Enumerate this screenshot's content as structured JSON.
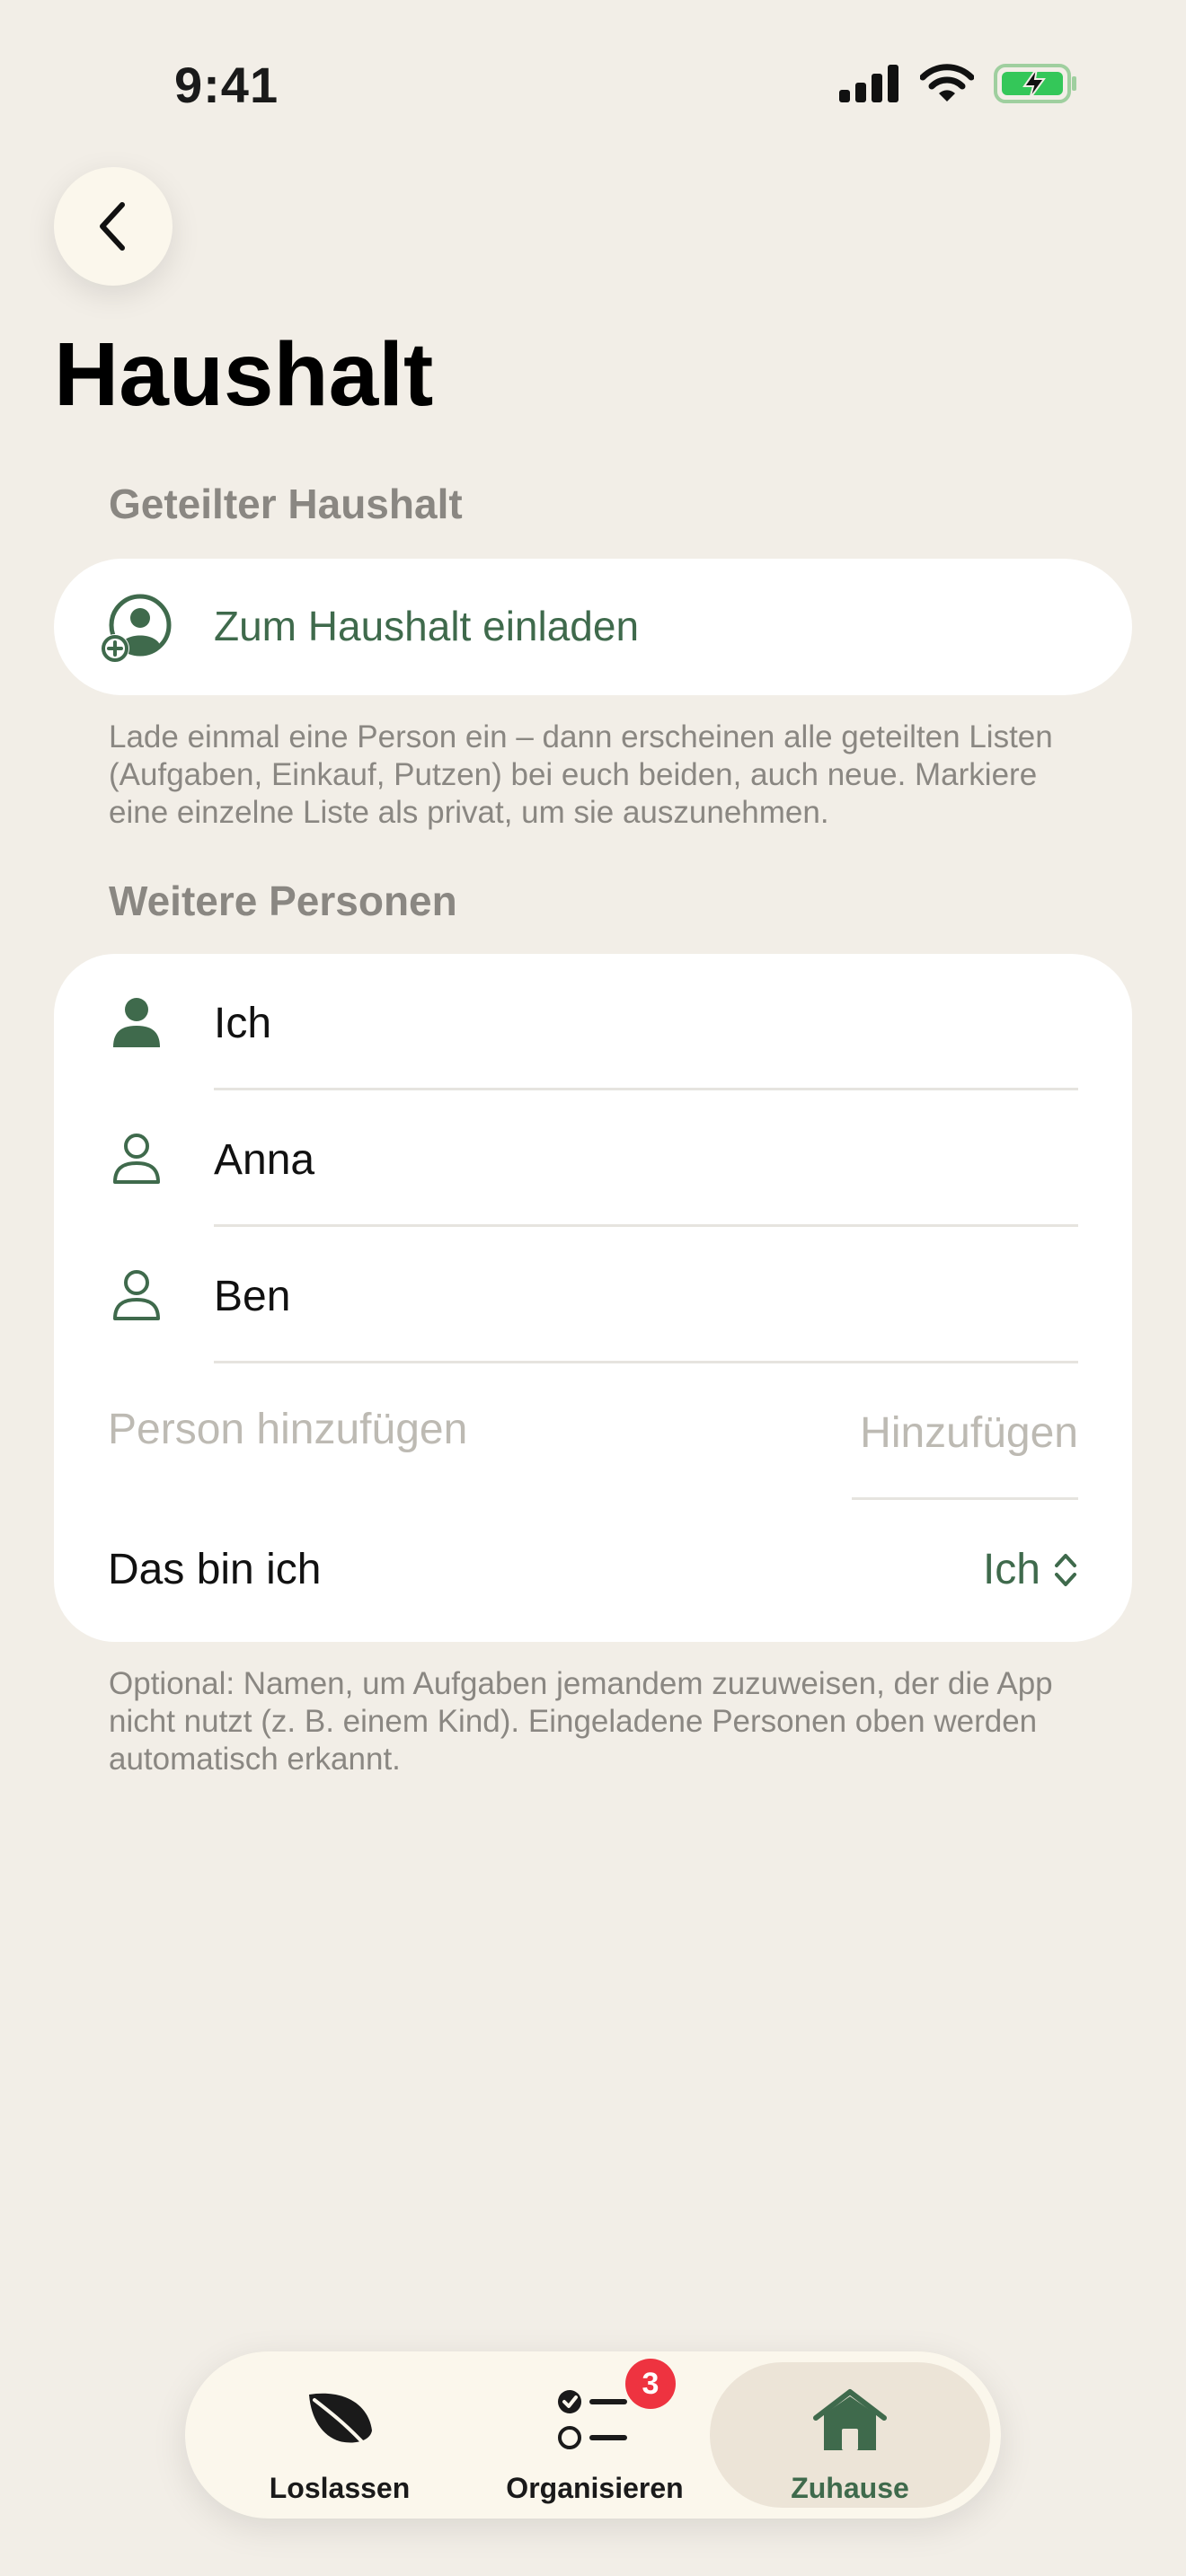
{
  "status_bar": {
    "time": "9:41"
  },
  "page": {
    "title": "Haushalt"
  },
  "shared_household": {
    "header": "Geteilter Haushalt",
    "invite_label": "Zum Haushalt einladen",
    "note": "Lade einmal eine Person ein – dann erscheinen alle geteilten Listen (Aufgaben, Einkauf, Putzen) bei euch beiden, auch neue. Markiere eine einzelne Liste als privat, um sie auszunehmen."
  },
  "more_people": {
    "header": "Weitere Personen",
    "people": [
      {
        "name": "Ich",
        "icon": "person-fill-icon"
      },
      {
        "name": "Anna",
        "icon": "person-outline-icon"
      },
      {
        "name": "Ben",
        "icon": "person-outline-icon"
      }
    ],
    "add_placeholder": "Person hinzufügen",
    "add_button": "Hinzufügen",
    "me_label": "Das bin ich",
    "me_value": "Ich",
    "note": "Optional: Namen, um Aufgaben jemandem zuzuweisen, der die App nicht nutzt (z. B. einem Kind). Eingeladene Personen oben werden automatisch erkannt."
  },
  "tab_bar": {
    "tabs": [
      {
        "label": "Loslassen",
        "icon": "leaf-icon"
      },
      {
        "label": "Organisieren",
        "icon": "checklist-icon",
        "badge": "3"
      },
      {
        "label": "Zuhause",
        "icon": "house-icon",
        "active": true
      }
    ]
  },
  "colors": {
    "background": "#f2eee7",
    "accent_green": "#3f6a4c",
    "badge_red": "#ee3340",
    "card": "#ffffff",
    "secondary_text": "#8a8782"
  }
}
